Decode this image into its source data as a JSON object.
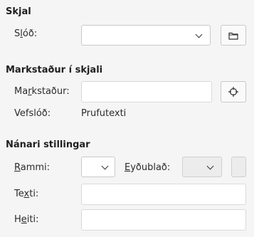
{
  "sections": {
    "document": {
      "title": "Skjal",
      "path_label_pre": "S",
      "path_label_u": "l",
      "path_label_post": "óð:"
    },
    "target": {
      "title": "Markstaður í skjali",
      "target_label_pre": "Ma",
      "target_label_u": "r",
      "target_label_post": "kstaður:",
      "url_label": "Vefslóð:",
      "url_value": "Prufutexti"
    },
    "further": {
      "title": "Nánari stillingar",
      "frame_label_u": "R",
      "frame_label_post": "ammi:",
      "form_label_u": "E",
      "form_label_post": "yðublað:",
      "text_label_pre": "Te",
      "text_label_u": "x",
      "text_label_post": "ti:",
      "name_label_pre": "H",
      "name_label_u": "e",
      "name_label_post": "iti:"
    }
  },
  "icons": {
    "open_file": "folder-icon",
    "target": "crosshair-icon",
    "dropdown": "chevron-down-icon"
  }
}
